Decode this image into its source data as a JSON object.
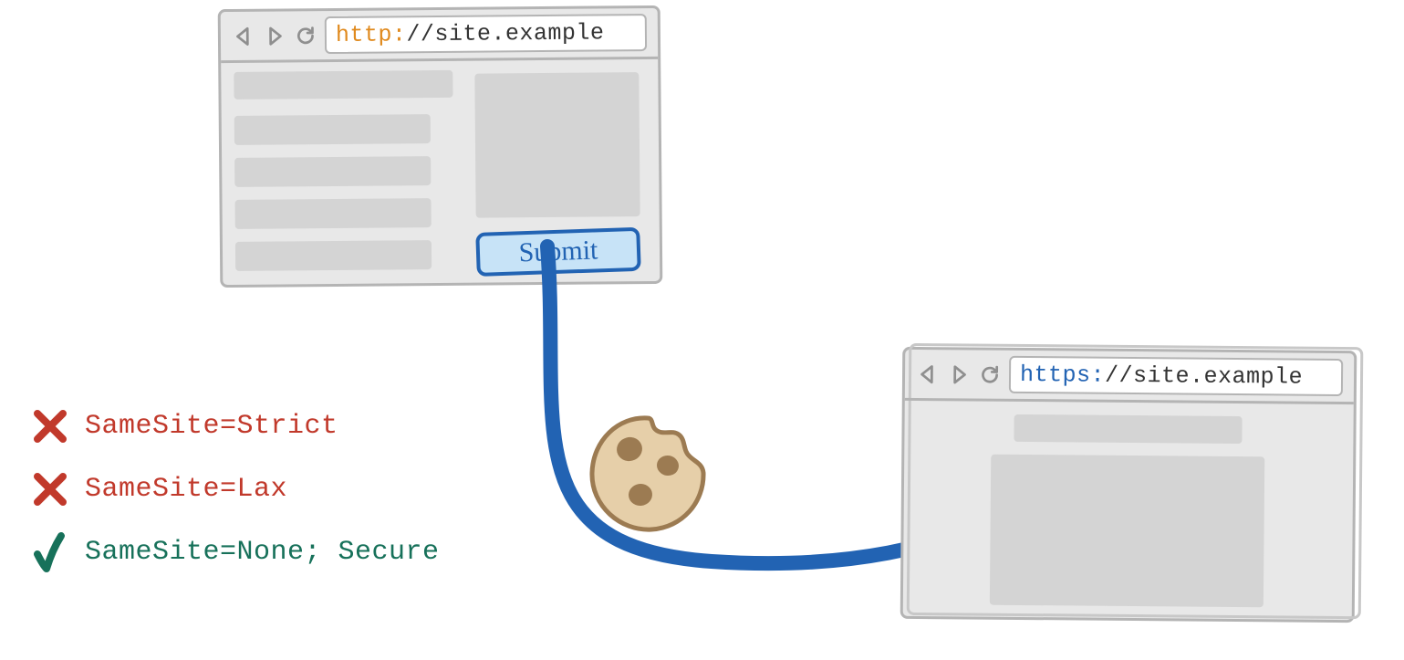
{
  "browser1": {
    "scheme": "http:",
    "host": "//site.example",
    "submit_label": "Submit"
  },
  "browser2": {
    "scheme": "https:",
    "host": "//site.example"
  },
  "legend": {
    "items": [
      {
        "text": "SameSite=Strict",
        "pass": false
      },
      {
        "text": "SameSite=Lax",
        "pass": false
      },
      {
        "text": "SameSite=None; Secure",
        "pass": true
      }
    ]
  },
  "icons": {
    "cookie": "cookie",
    "arrow": "request-arrow"
  }
}
